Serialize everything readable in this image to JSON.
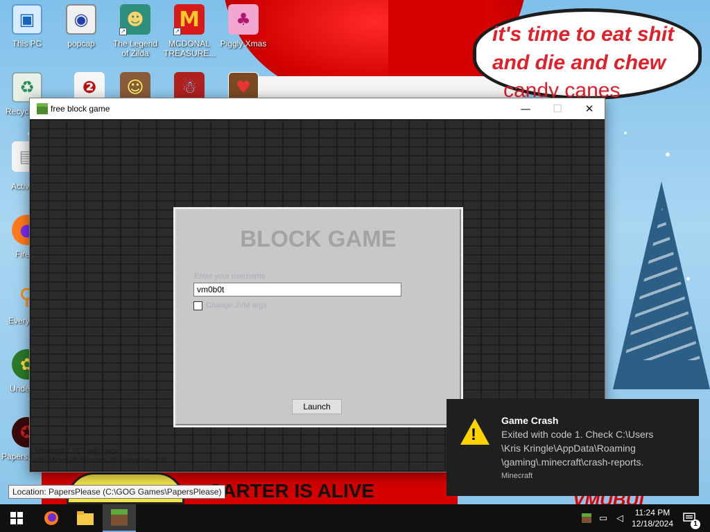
{
  "wallpaper": {
    "speech_line1": "it's time to eat shit",
    "speech_line2": "and die and chew",
    "speech_line3": "candy canes",
    "banner": "CARTER IS ALIVE",
    "tag": "VMUBUI"
  },
  "desktop_icons": [
    {
      "label": "This PC",
      "icon": "computer-icon"
    },
    {
      "label": "popcap",
      "icon": "popcap-icon"
    },
    {
      "label": "The Legend",
      "label2": "of Zilda",
      "icon": "zilda-icon"
    },
    {
      "label": "MCDONAL",
      "label2": "TREASURE...",
      "icon": "mcdonalds-icon"
    },
    {
      "label": "Piggly Xmas",
      "icon": "pig-icon"
    },
    {
      "label": "Recycl",
      "icon": "recycle-bin-icon"
    },
    {
      "label": "Activ",
      "icon": "file-icon"
    },
    {
      "label": "Firef",
      "icon": "firefox-icon"
    },
    {
      "label": "Everyt",
      "icon": "search-app-icon"
    },
    {
      "label": "Unde",
      "icon": "undertale-icon"
    },
    {
      "label": "Papers,",
      "icon": "papers-please-icon"
    }
  ],
  "window": {
    "title": "free block game",
    "minimize_glyph": "—",
    "maximize_glyph": "☐",
    "close_glyph": "✕",
    "footer_line1": "Minecraft 1.19.2 with Forge",
    "footer_line2": "OS: Microsoft Windows 10 Enterprise LTSC"
  },
  "launcher": {
    "title": "BLOCK GAME",
    "username_label": "Enter your username",
    "username_value": "vm0b0t",
    "checkbox_label": "Change JVM args",
    "checkbox_checked": false,
    "launch_label": "Launch"
  },
  "toast": {
    "title": "Game Crash",
    "line1": "Exited with code 1. Check C:\\Users",
    "line2": "\\Kris Kringle\\AppData\\Roaming",
    "line3": "\\gaming\\.minecraft\\crash-reports.",
    "source": "Minecraft",
    "icon": "warning-icon",
    "icon_color": "#ffd400"
  },
  "tooltip": {
    "text": "Location: PapersPlease (C:\\GOG Games\\PapersPlease)"
  },
  "taskbar": {
    "items": [
      "windows-start-icon",
      "firefox-icon",
      "file-explorer-icon",
      "minecraft-icon"
    ],
    "time": "11:24 PM",
    "date": "12/18/2024",
    "notification_count": "1"
  },
  "colors": {
    "accent_red": "#d40000",
    "speech_text": "#e0202a",
    "panel_bg": "#c8c8c8",
    "toast_bg": "#1f1f1f"
  }
}
